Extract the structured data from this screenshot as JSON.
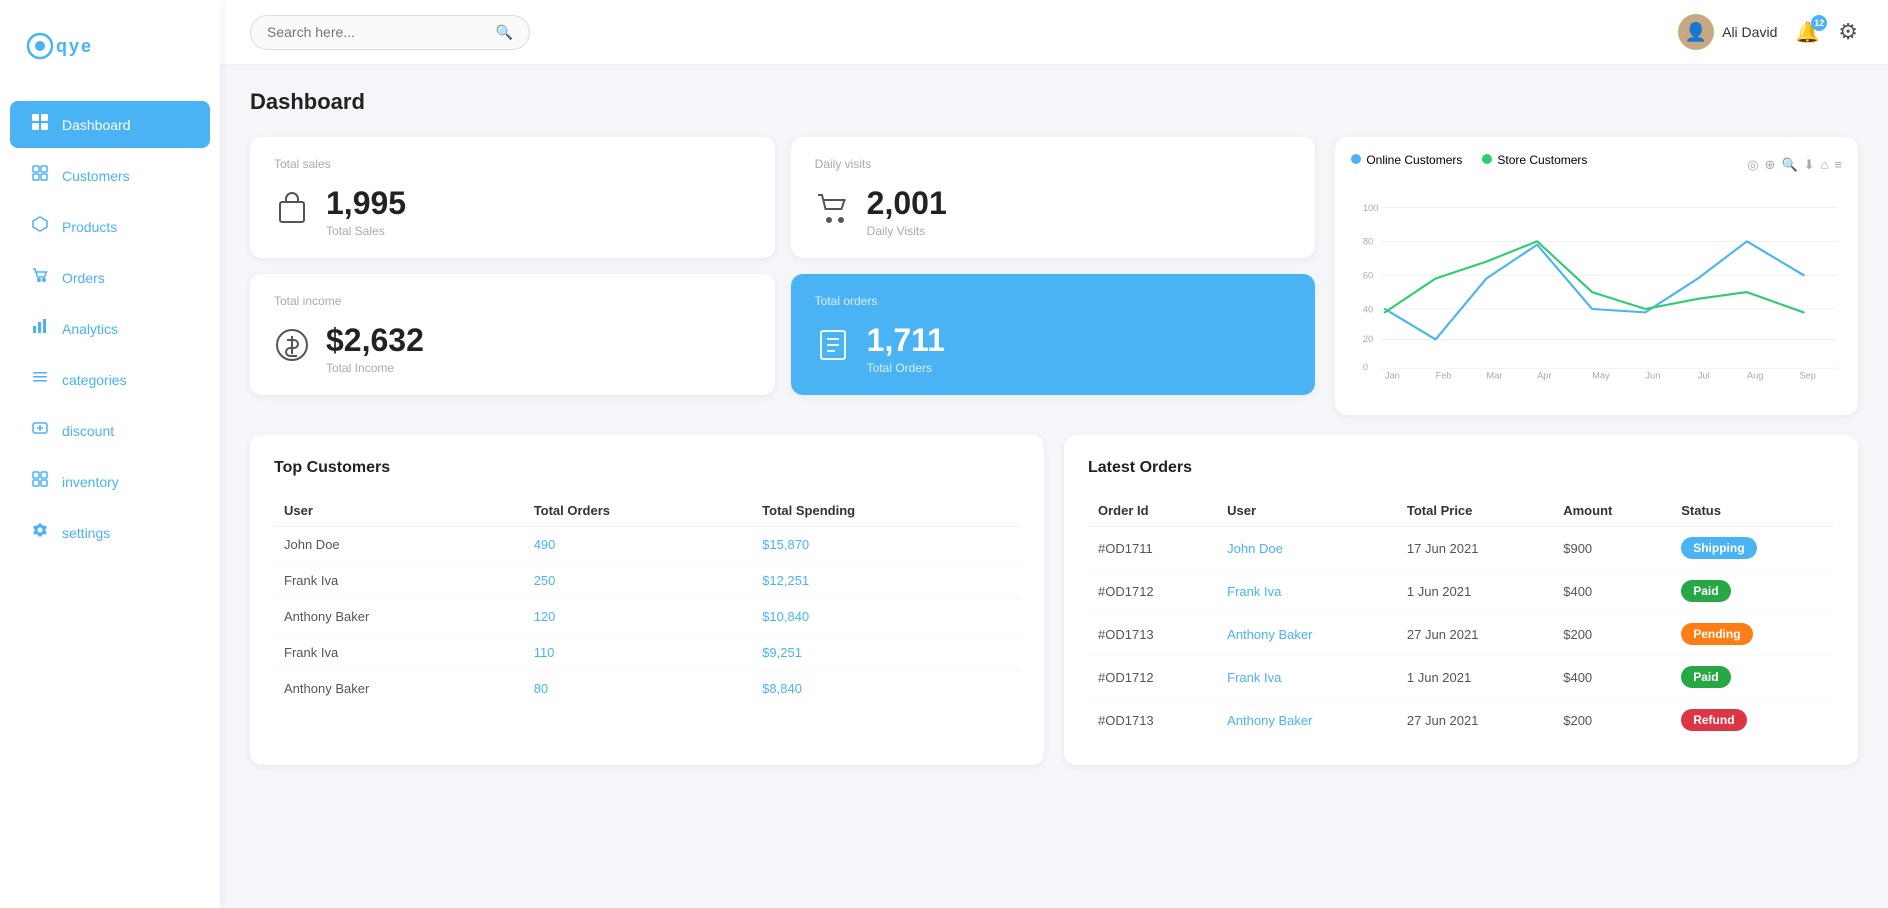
{
  "app": {
    "logo": "qye",
    "title": "Dashboard"
  },
  "topbar": {
    "search_placeholder": "Search here...",
    "user_name": "Ali David",
    "notif_count": "12"
  },
  "sidebar": {
    "items": [
      {
        "id": "dashboard",
        "label": "Dashboard",
        "icon": "⊞",
        "active": true
      },
      {
        "id": "customers",
        "label": "Customers",
        "icon": "👤",
        "active": false
      },
      {
        "id": "products",
        "label": "Products",
        "icon": "⬡",
        "active": false
      },
      {
        "id": "orders",
        "label": "Orders",
        "icon": "🛒",
        "active": false
      },
      {
        "id": "analytics",
        "label": "Analytics",
        "icon": "📊",
        "active": false
      },
      {
        "id": "categories",
        "label": "categories",
        "icon": "☰",
        "active": false
      },
      {
        "id": "discount",
        "label": "discount",
        "icon": "🎁",
        "active": false
      },
      {
        "id": "inventory",
        "label": "inventory",
        "icon": "⊞",
        "active": false
      },
      {
        "id": "settings",
        "label": "settings",
        "icon": "⚙",
        "active": false
      }
    ]
  },
  "stats": {
    "total_sales": {
      "label": "Total sales",
      "value": "1,995",
      "sublabel": "Total Sales"
    },
    "daily_visits": {
      "label": "Daily visits",
      "value": "2,001",
      "sublabel": "Daily Visits"
    },
    "total_income": {
      "label": "Total income",
      "value": "$2,632",
      "sublabel": "Total Income"
    },
    "total_orders": {
      "label": "Total orders",
      "value": "1,711",
      "sublabel": "Total Orders"
    }
  },
  "chart": {
    "legend": [
      {
        "label": "Online Customers",
        "color": "#4ab3f4"
      },
      {
        "label": "Store Customers",
        "color": "#2ecc71"
      }
    ],
    "x_labels": [
      "Jan",
      "Feb",
      "Mar",
      "Apr",
      "May",
      "Jun",
      "Jul",
      "Aug",
      "Sep"
    ],
    "y_labels": [
      "0",
      "20",
      "40",
      "60",
      "80",
      "100"
    ]
  },
  "top_customers": {
    "title": "Top Customers",
    "headers": [
      "User",
      "Total Orders",
      "Total Spending"
    ],
    "rows": [
      {
        "user": "John Doe",
        "orders": "490",
        "spending": "$15,870"
      },
      {
        "user": "Frank Iva",
        "orders": "250",
        "spending": "$12,251"
      },
      {
        "user": "Anthony Baker",
        "orders": "120",
        "spending": "$10,840"
      },
      {
        "user": "Frank Iva",
        "orders": "110",
        "spending": "$9,251"
      },
      {
        "user": "Anthony Baker",
        "orders": "80",
        "spending": "$8,840"
      }
    ]
  },
  "latest_orders": {
    "title": "Latest Orders",
    "headers": [
      "Order Id",
      "User",
      "Total Price",
      "Amount",
      "Status"
    ],
    "rows": [
      {
        "order_id": "#OD1711",
        "user": "John Doe",
        "date": "17 Jun 2021",
        "amount": "$900",
        "status": "Shipping",
        "status_class": "status-shipping"
      },
      {
        "order_id": "#OD1712",
        "user": "Frank Iva",
        "date": "1 Jun 2021",
        "amount": "$400",
        "status": "Paid",
        "status_class": "status-paid"
      },
      {
        "order_id": "#OD1713",
        "user": "Anthony Baker",
        "date": "27 Jun 2021",
        "amount": "$200",
        "status": "Pending",
        "status_class": "status-pending"
      },
      {
        "order_id": "#OD1712",
        "user": "Frank Iva",
        "date": "1 Jun 2021",
        "amount": "$400",
        "status": "Paid",
        "status_class": "status-paid"
      },
      {
        "order_id": "#OD1713",
        "user": "Anthony Baker",
        "date": "27 Jun 2021",
        "amount": "$200",
        "status": "Refund",
        "status_class": "status-refund"
      }
    ]
  }
}
